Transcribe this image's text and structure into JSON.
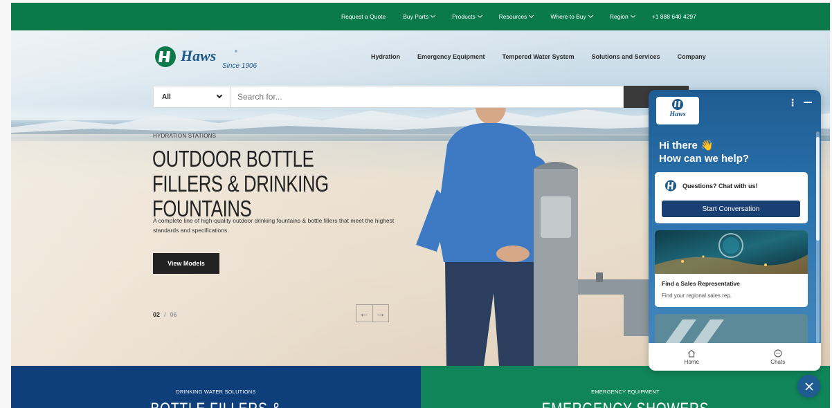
{
  "topbar": {
    "links": [
      {
        "label": "Request a Quote",
        "dropdown": false
      },
      {
        "label": "Buy Parts",
        "dropdown": true
      },
      {
        "label": "Products",
        "dropdown": true
      },
      {
        "label": "Resources",
        "dropdown": true
      },
      {
        "label": "Where to Buy",
        "dropdown": true
      },
      {
        "label": "Region",
        "dropdown": true
      },
      {
        "label": "+1 888 640 4297",
        "dropdown": false
      }
    ],
    "color": "#0b7a4b"
  },
  "brand": {
    "since": "Since 1906",
    "color": "#1d5a8c"
  },
  "mainnav": {
    "items": [
      "Hydration",
      "Emergency Equipment",
      "Tempered Water System",
      "Solutions and Services",
      "Company"
    ]
  },
  "search": {
    "category": "All",
    "placeholder": "Search for...",
    "button_label": "S"
  },
  "hero": {
    "eyebrow": "HYDRATION STATIONS",
    "headline": "OUTDOOR BOTTLE FILLERS & DRINKING FOUNTAINS",
    "description": "A complete line of high-quality outdoor drinking fountains & bottle fillers that meet the highest standards and specifications.",
    "cta": "View Models",
    "slide_current": "02",
    "slide_separator": "/",
    "slide_total": "06"
  },
  "tiles": [
    {
      "eyebrow": "DRINKING WATER SOLUTIONS",
      "title": "BOTTLE FILLERS &",
      "color": "#0e3f7a"
    },
    {
      "eyebrow": "EMERGENCY EQUIPMENT",
      "title": "EMERGENCY SHOWERS",
      "color": "#10855a"
    }
  ],
  "chat": {
    "greeting": "Hi there",
    "wave_icon": "👋",
    "subtitle": "How can we help?",
    "questions_label": "Questions? Chat with us!",
    "start_label": "Start Conversation",
    "card_title": "Find a Sales Representative",
    "card_subtitle": "Find your regional sales rep.",
    "footer": {
      "home": "Home",
      "chats": "Chats"
    },
    "since": "Since 1906"
  }
}
